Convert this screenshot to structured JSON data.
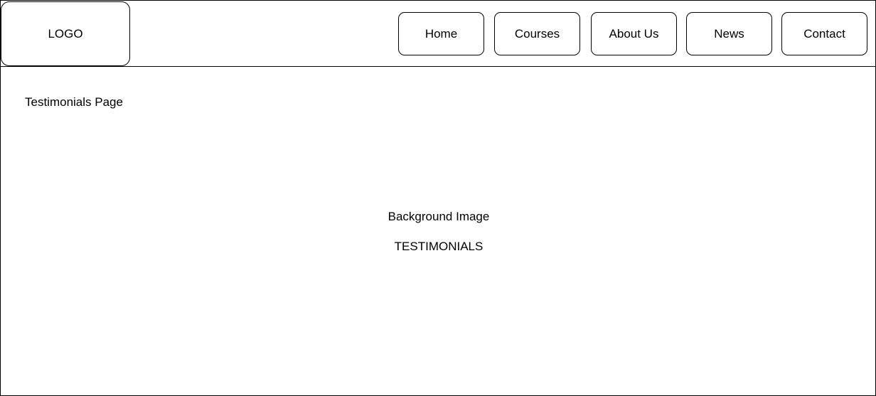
{
  "header": {
    "logo": "LOGO",
    "nav": [
      {
        "label": "Home"
      },
      {
        "label": "Courses"
      },
      {
        "label": "About Us"
      },
      {
        "label": "News"
      },
      {
        "label": "Contact"
      }
    ]
  },
  "main": {
    "page_label": "Testimonials Page",
    "background_label": "Background Image",
    "hero_title": "TESTIMONIALS"
  }
}
